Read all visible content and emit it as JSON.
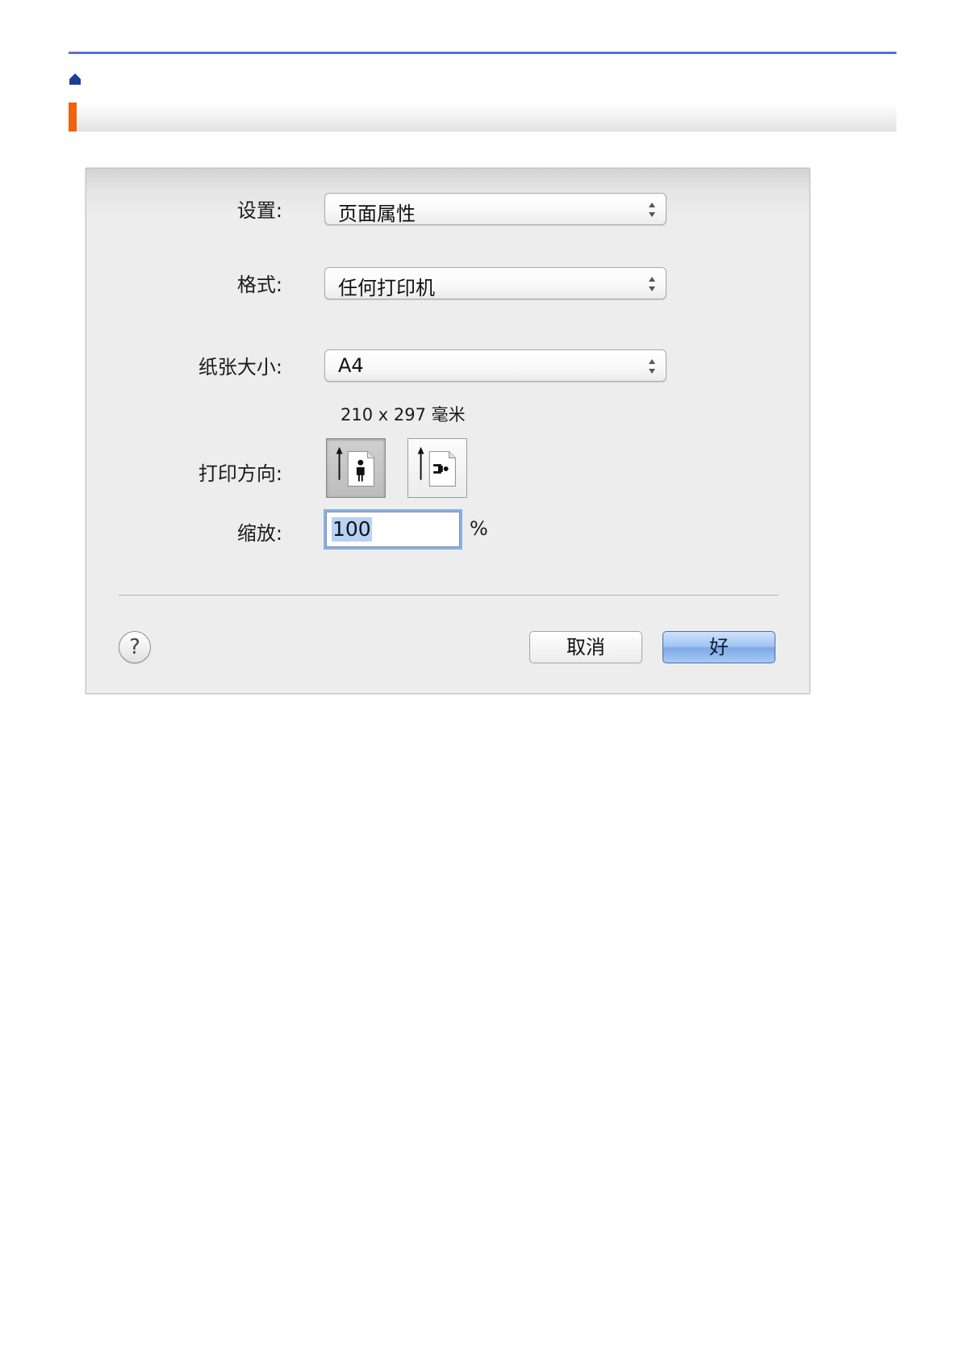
{
  "page": {
    "home_icon": "home-icon",
    "header_accent_color": "#f0620c",
    "rule_color": "#5b6fd3"
  },
  "dialog": {
    "settings_label": "设置:",
    "settings_value": "页面属性",
    "format_label": "格式:",
    "format_value": "任何打印机",
    "paper_size_label": "纸张大小:",
    "paper_size_value": "A4",
    "paper_dimensions": "210 x 297 毫米",
    "orientation_label": "打印方向:",
    "orientation_options": [
      "portrait-icon",
      "landscape-icon"
    ],
    "orientation_selected": "portrait",
    "scale_label": "缩放:",
    "scale_value": "100",
    "scale_unit": "%",
    "help_label": "?",
    "cancel_label": "取消",
    "ok_label": "好"
  }
}
